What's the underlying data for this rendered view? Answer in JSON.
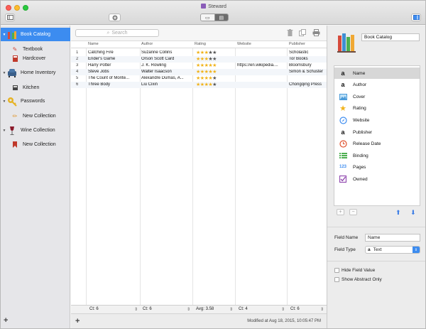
{
  "window": {
    "title": "Steward"
  },
  "search": {
    "placeholder": "Search"
  },
  "sidebar": {
    "groups": [
      {
        "label": "Book Catalog",
        "icon": "book-catalog-icon",
        "selected": true,
        "children": [
          {
            "label": "Textbook",
            "icon": "textbook-icon"
          },
          {
            "label": "Hardcover",
            "icon": "hardcover-icon"
          }
        ]
      },
      {
        "label": "Home Inventory",
        "icon": "armchair-icon",
        "children": [
          {
            "label": "Kitchen",
            "icon": "kitchen-icon"
          }
        ]
      },
      {
        "label": "Passwords",
        "icon": "key-icon",
        "children": [
          {
            "label": "New Collection",
            "icon": "pencil-icon"
          }
        ]
      },
      {
        "label": "Wine Collection",
        "icon": "wine-glass-icon",
        "children": [
          {
            "label": "New Collection",
            "icon": "bookmark-icon"
          }
        ]
      }
    ],
    "add_label": "+"
  },
  "table": {
    "columns": [
      "",
      "Name",
      "Author",
      "Rating",
      "Website",
      "Publisher"
    ],
    "rows": [
      {
        "n": "1",
        "name": "Catching Fire",
        "author": "Suzanne Collins",
        "rating": 3,
        "website": "",
        "publisher": "Scholastic"
      },
      {
        "n": "2",
        "name": "Ender's Game",
        "author": "Orson Scott Card",
        "rating": 3,
        "website": "",
        "publisher": "Tor Books"
      },
      {
        "n": "3",
        "name": "Harry Potter",
        "author": "J. K. Rowling",
        "rating": 5,
        "website": "https://en.wikipedia....",
        "publisher": "Bloomsbury"
      },
      {
        "n": "4",
        "name": "Steve Jobs",
        "author": "Walter Isaacson",
        "rating": 5,
        "website": "",
        "publisher": "Simon & Schuster"
      },
      {
        "n": "5",
        "name": "The Count of Monte...",
        "author": "Alexandre Dumas, A...",
        "rating": 4,
        "website": "",
        "publisher": ""
      },
      {
        "n": "6",
        "name": "Three Body",
        "author": "Liu Cixin",
        "rating": 4,
        "website": "",
        "publisher": "Chongqing Press"
      }
    ],
    "footer": {
      "name": "Ct: 6",
      "author": "Ct: 6",
      "rating": "Avg: 3.58",
      "website": "Ct: 4",
      "publisher": "Ct: 6"
    },
    "status": "Modified at Aug 18, 2015, 10:05:47 PM",
    "add_label": "+"
  },
  "panel": {
    "catalog_name": "Book Catalog",
    "fields": [
      {
        "label": "Name",
        "icon": "letter-a-icon",
        "selected": true
      },
      {
        "label": "Author",
        "icon": "letter-a-icon"
      },
      {
        "label": "Cover",
        "icon": "image-icon"
      },
      {
        "label": "Rating",
        "icon": "star-icon"
      },
      {
        "label": "Website",
        "icon": "compass-icon"
      },
      {
        "label": "Publisher",
        "icon": "letter-a-icon"
      },
      {
        "label": "Release Date",
        "icon": "clock-icon"
      },
      {
        "label": "Binding",
        "icon": "list-icon"
      },
      {
        "label": "Pages",
        "icon": "number-icon"
      },
      {
        "label": "Owned",
        "icon": "checkbox-icon"
      }
    ],
    "icon_glyphs": {
      "number_text": "123",
      "letter": "a"
    },
    "field_name_label": "Field Name",
    "field_name_value": "Name",
    "field_type_label": "Field Type",
    "field_type_value": "Text",
    "hide_field_value": "Hide Field Value",
    "show_abstract_only": "Show Abstract Only",
    "add_label": "+",
    "remove_label": "−"
  },
  "colors": {
    "accent": "#3c8cf0",
    "star": "#f1b31b",
    "selection": "#d7d7d7"
  }
}
